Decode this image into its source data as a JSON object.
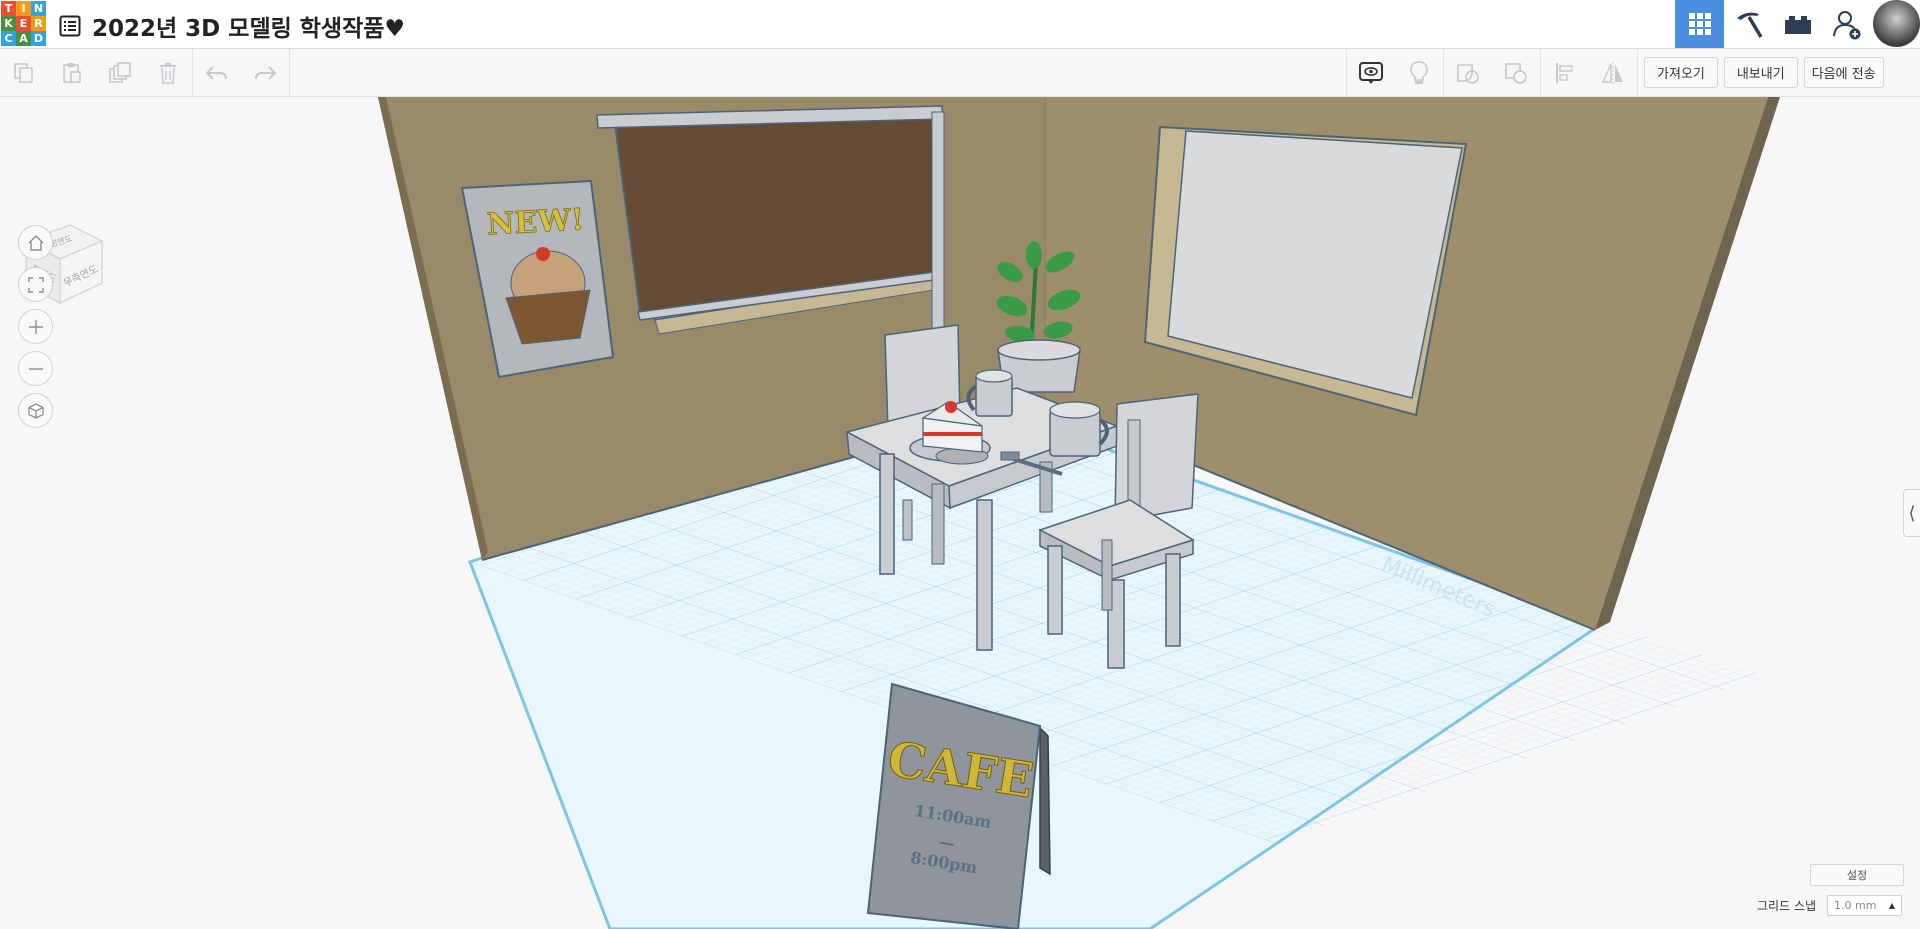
{
  "app": {
    "logo_letters": [
      "T",
      "I",
      "N",
      "K",
      "E",
      "R",
      "C",
      "A",
      "D"
    ],
    "logo_colors": [
      "#e8502f",
      "#f49b1c",
      "#31a4e0",
      "#4a8e3f",
      "#e8502f",
      "#f49b1c",
      "#31a4e0",
      "#4a8e3f",
      "#31a4e0"
    ],
    "title": "2022년 3D 모델링 학생작품♥"
  },
  "top_nav": {
    "items": [
      "grid-view-icon",
      "pickaxe-icon",
      "brick-icon",
      "add-user-icon",
      "avatar"
    ],
    "active_color": "#4a8ee0"
  },
  "toolbar": {
    "import_label": "가져오기",
    "export_label": "내보내기",
    "send_to_label": "다음에 전송"
  },
  "viewcube": {
    "front_label": "정면도",
    "right_label": "우측면도",
    "top_label": "평면도"
  },
  "scene": {
    "poster_text": "NEW!",
    "sign_title": "CAFE",
    "sign_hours_open": "11:00am",
    "sign_dash": "—",
    "sign_hours_close": "8:00pm",
    "grid_label": "Millimeters"
  },
  "bottom": {
    "settings_label": "설정",
    "snap_label": "그리드 스냅",
    "snap_value": "1.0 mm"
  }
}
